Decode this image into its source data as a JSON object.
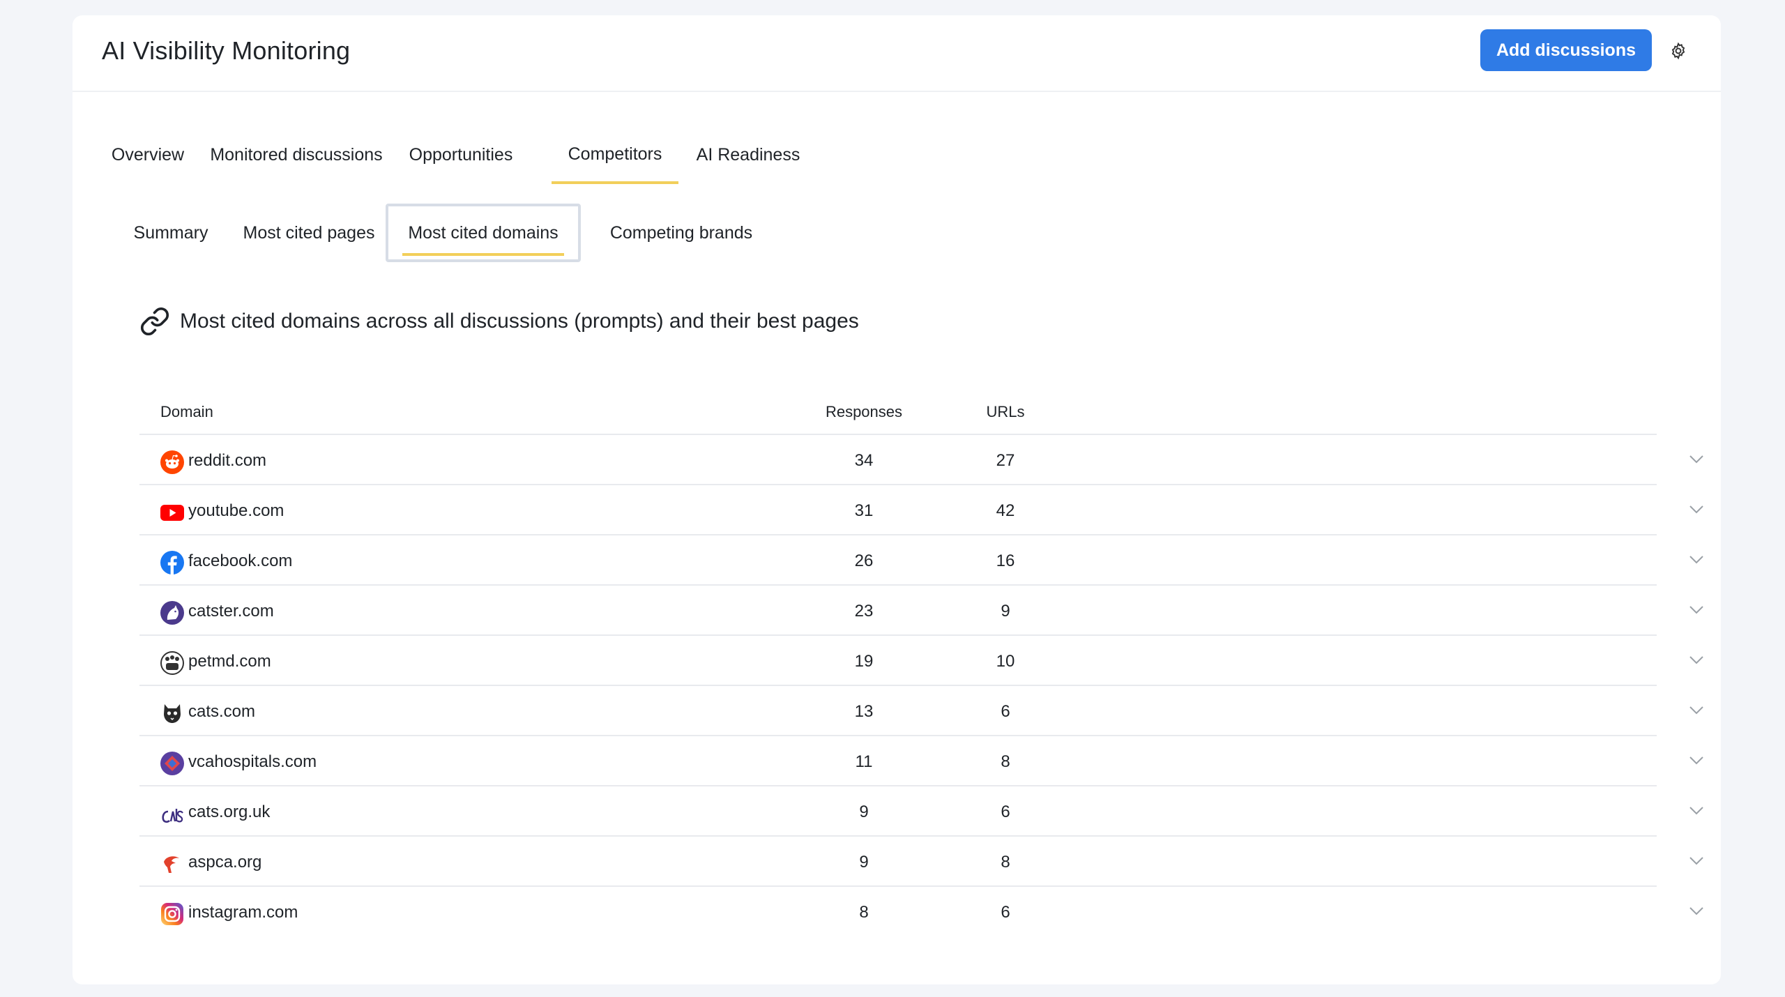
{
  "header": {
    "title": "AI Visibility Monitoring",
    "add_button": "Add discussions",
    "settings_icon": "gear-icon"
  },
  "tabs": [
    {
      "label": "Overview"
    },
    {
      "label": "Monitored discussions"
    },
    {
      "label": "Opportunities"
    },
    {
      "label": "Competitors",
      "active": true
    },
    {
      "label": "AI Readiness"
    }
  ],
  "subtabs": [
    {
      "label": "Summary"
    },
    {
      "label": "Most cited pages"
    },
    {
      "label": "Most cited domains",
      "active": true
    },
    {
      "label": "Competing brands"
    }
  ],
  "section": {
    "icon": "link-icon",
    "title": "Most cited domains across all discussions (prompts) and their best pages"
  },
  "table": {
    "columns": {
      "domain": "Domain",
      "responses": "Responses",
      "urls": "URLs"
    },
    "rows": [
      {
        "domain": "reddit.com",
        "responses": "34",
        "urls": "27",
        "icon": "reddit-icon",
        "color": "#ff4500"
      },
      {
        "domain": "youtube.com",
        "responses": "31",
        "urls": "42",
        "icon": "youtube-icon",
        "color": "#ff0000"
      },
      {
        "domain": "facebook.com",
        "responses": "26",
        "urls": "16",
        "icon": "facebook-icon",
        "color": "#1877f2"
      },
      {
        "domain": "catster.com",
        "responses": "23",
        "urls": "9",
        "icon": "catster-icon",
        "color": "#4b3a8c"
      },
      {
        "domain": "petmd.com",
        "responses": "19",
        "urls": "10",
        "icon": "petmd-icon",
        "color": "#333333"
      },
      {
        "domain": "cats.com",
        "responses": "13",
        "urls": "6",
        "icon": "cats-com-icon",
        "color": "#222222"
      },
      {
        "domain": "vcahospitals.com",
        "responses": "11",
        "urls": "8",
        "icon": "vca-icon",
        "color": "#5a3fa0"
      },
      {
        "domain": "cats.org.uk",
        "responses": "9",
        "urls": "6",
        "icon": "cats-org-uk-icon",
        "color": "#3d2e80"
      },
      {
        "domain": "aspca.org",
        "responses": "9",
        "urls": "8",
        "icon": "aspca-icon",
        "color": "#e2412c"
      },
      {
        "domain": "instagram.com",
        "responses": "8",
        "urls": "6",
        "icon": "instagram-icon",
        "color": "#d62976"
      }
    ]
  },
  "colors": {
    "accent": "#2f7be6",
    "tab_underline": "#f2cf5a",
    "background": "#f3f5f9"
  }
}
